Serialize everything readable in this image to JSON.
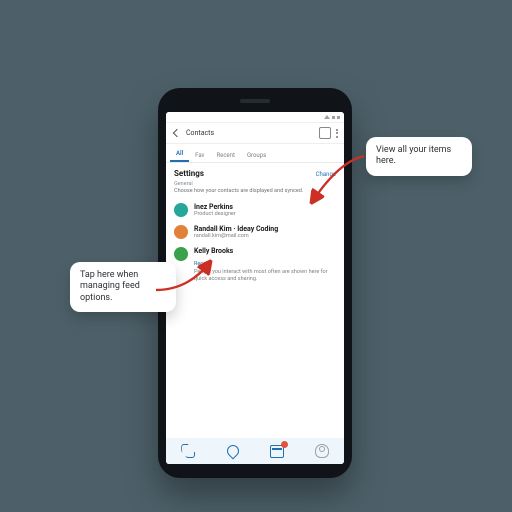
{
  "appbar": {
    "title": "Contacts"
  },
  "tabs": {
    "items": [
      {
        "label": "All"
      },
      {
        "label": "Fav"
      },
      {
        "label": "Recent"
      },
      {
        "label": "Groups"
      }
    ],
    "activeIndex": 0
  },
  "section": {
    "title": "Settings",
    "link": "Change"
  },
  "intro": {
    "label": "General",
    "desc": "Choose how your contacts are displayed and synced."
  },
  "items": [
    {
      "name": "Inez Perkins",
      "sub": "Product designer",
      "avatar": "teal"
    },
    {
      "name": "Randall Kim · Ideay Coding",
      "sub": "randall.kim@mail.com",
      "avatar": "orange"
    },
    {
      "name": "Kelly Brooks",
      "sub": "",
      "avatar": "green"
    }
  ],
  "group": {
    "label": "Recent",
    "desc": "People you interact with most often are shown here for quick access and sharing."
  },
  "callouts": {
    "left": "Tap here when managing feed options.",
    "right": "View all your items here."
  }
}
